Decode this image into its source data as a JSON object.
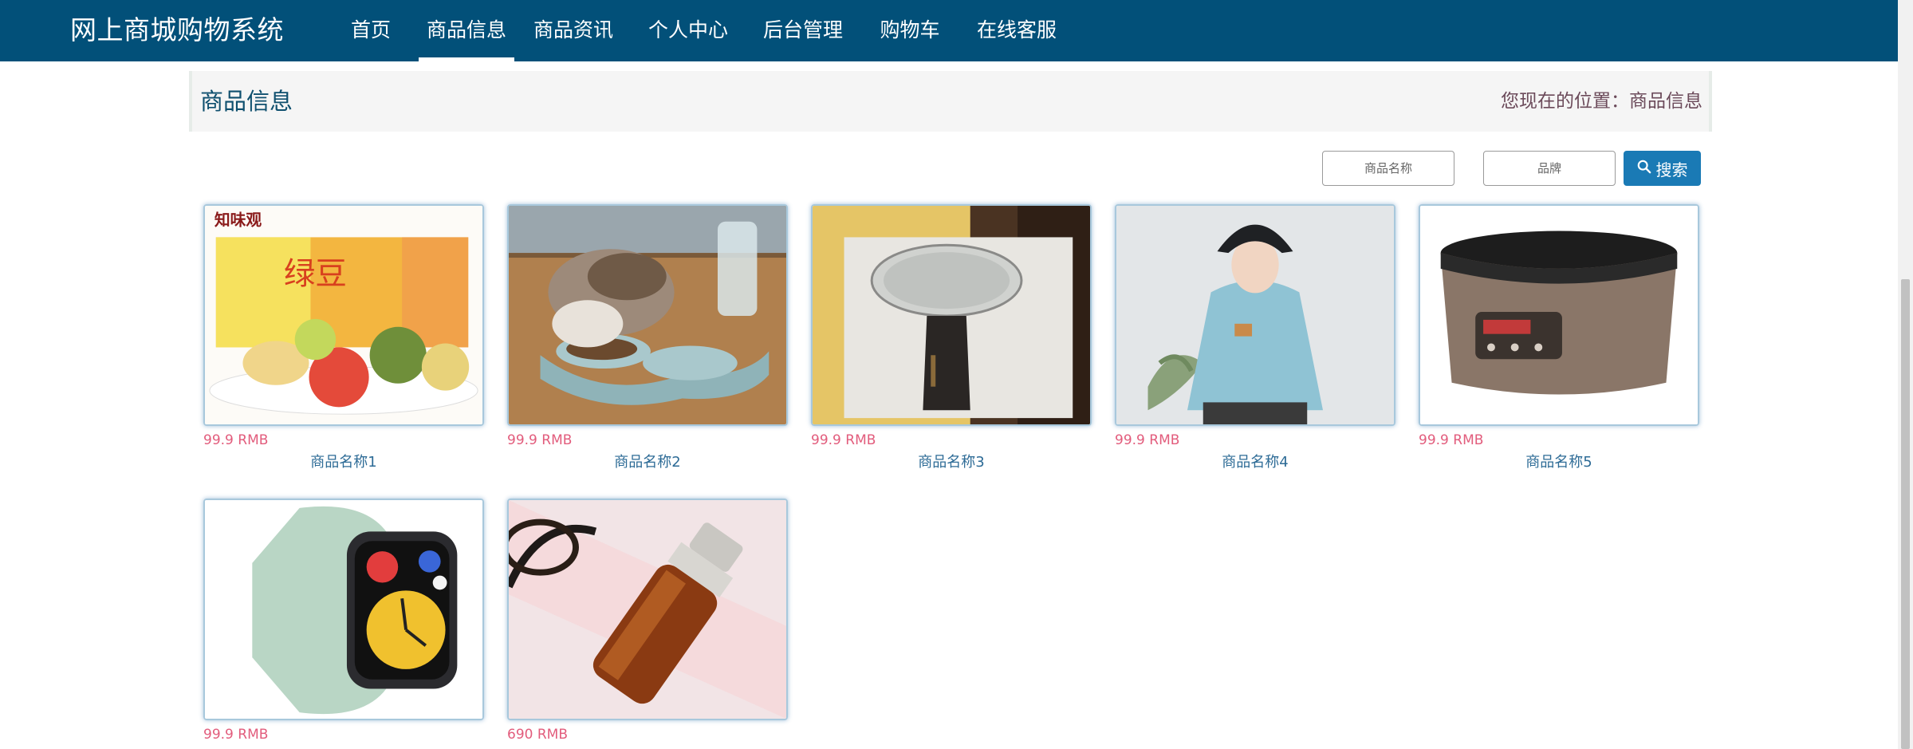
{
  "header": {
    "brand": "网上商城购物系统",
    "nav": [
      {
        "label": "首页"
      },
      {
        "label": "商品信息",
        "active": true
      },
      {
        "label": "商品资讯"
      },
      {
        "label": "个人中心"
      },
      {
        "label": "后台管理"
      },
      {
        "label": "购物车"
      },
      {
        "label": "在线客服"
      }
    ]
  },
  "title_bar": {
    "title": "商品信息",
    "breadcrumb": "您现在的位置：商品信息"
  },
  "search": {
    "name_placeholder": "商品名称",
    "brand_placeholder": "品牌",
    "button_label": "搜索"
  },
  "products": [
    {
      "price": "99.9 RMB",
      "name": "商品名称1",
      "image": "mooncake-box"
    },
    {
      "price": "99.9 RMB",
      "name": "商品名称2",
      "image": "cat-feeder"
    },
    {
      "price": "99.9 RMB",
      "name": "商品名称3",
      "image": "kitchen-scale"
    },
    {
      "price": "99.9 RMB",
      "name": "商品名称4",
      "image": "blue-hoodie"
    },
    {
      "price": "99.9 RMB",
      "name": "商品名称5",
      "image": "rice-cooker"
    },
    {
      "price": "99.9 RMB",
      "name": "",
      "image": "smartwatch"
    },
    {
      "price": "690 RMB",
      "name": "",
      "image": "serum-bottle"
    }
  ],
  "colors": {
    "nav_bg": "#025079",
    "price": "#e25c7c",
    "product_name": "#2d6b96",
    "search_button": "#1a7ab5"
  }
}
